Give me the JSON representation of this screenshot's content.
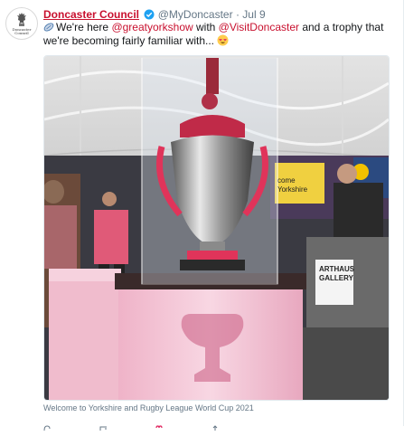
{
  "tweet": {
    "author_name": "Doncaster Council",
    "avatar_text": "Doncaster Council",
    "handle": "@MyDoncaster",
    "separator": "·",
    "date": "Jul 9",
    "text_part1": "We're here ",
    "mention1": "@greatyorkshow",
    "text_part2": " with ",
    "mention2": "@VisitDoncaster",
    "text_part3": " and a trophy that we're becoming fairly familiar with... ",
    "media_sign_1": "come",
    "media_sign_2": "Yorkshire",
    "media_sign_3": "ARTHAUS",
    "media_sign_4": "GALLERY",
    "caption": "Welcome to Yorkshire and Rugby League World Cup 2021"
  },
  "colors": {
    "brand_red": "#c8102e",
    "verified_blue": "#1da1f2",
    "muted_text": "#657786",
    "tent_canopy": "#ececec",
    "trophy_base": "#f4c6d6"
  },
  "icons": [
    "doncaster-crest-icon",
    "verified-badge-icon",
    "rugby-ball-icon",
    "heart-eyes-emoji-icon",
    "reply-icon",
    "retweet-icon",
    "like-icon",
    "share-icon"
  ]
}
